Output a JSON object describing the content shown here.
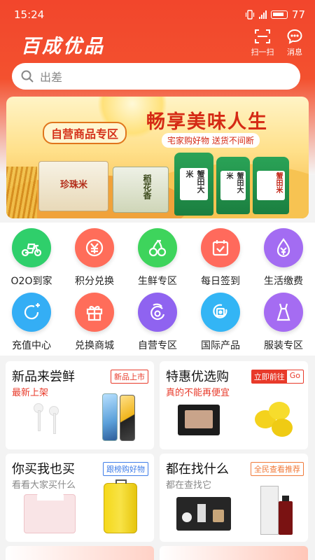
{
  "status": {
    "time": "15:24",
    "battery": "77"
  },
  "header": {
    "logo": "百成优品",
    "scan_label": "扫一扫",
    "message_label": "消息"
  },
  "search": {
    "placeholder": "出差"
  },
  "banner": {
    "pill": "自营商品专区",
    "headline": "畅享美味人生",
    "sub": "宅家购好物 送货不间断",
    "pkg_labels": [
      "珍珠米",
      "稻花香",
      "蟹田大米",
      "蟹田大米",
      "蟹田米"
    ]
  },
  "categories": [
    {
      "label": "O2O到家",
      "icon": "scooter-icon",
      "color": "#2fcf6b"
    },
    {
      "label": "积分兑换",
      "icon": "coin-icon",
      "color": "#ff6d5a"
    },
    {
      "label": "生鲜专区",
      "icon": "cherry-icon",
      "color": "#3ed45c"
    },
    {
      "label": "每日签到",
      "icon": "calendar-icon",
      "color": "#ff6a5c"
    },
    {
      "label": "生活缴费",
      "icon": "yen-drop-icon",
      "color": "#a36cf2"
    },
    {
      "label": "充值中心",
      "icon": "recharge-icon",
      "color": "#34aef5"
    },
    {
      "label": "兑换商城",
      "icon": "gift-icon",
      "color": "#ff6d5a"
    },
    {
      "label": "自营专区",
      "icon": "brand-icon",
      "color": "#8f63f0"
    },
    {
      "label": "国际产品",
      "icon": "globe-icon",
      "color": "#33b5f5"
    },
    {
      "label": "服装专区",
      "icon": "dress-icon",
      "color": "#a56cf2"
    }
  ],
  "cards": [
    {
      "title": "新品来尝鲜",
      "subtitle": "最新上架",
      "badge": "新品上市",
      "color": "#e83a2a"
    },
    {
      "title": "特惠优选购",
      "subtitle": "真的不能再便宜",
      "badge": "立即前往",
      "badge2": "Go",
      "color": "#e83a2a"
    },
    {
      "title": "你买我也买",
      "subtitle": "看看大家买什么",
      "badge": "跟榜购好物",
      "color": "#3f7de8"
    },
    {
      "title": "都在找什么",
      "subtitle": "都在查找它",
      "badge": "全民查看推荐",
      "color": "#f07a3a"
    }
  ]
}
